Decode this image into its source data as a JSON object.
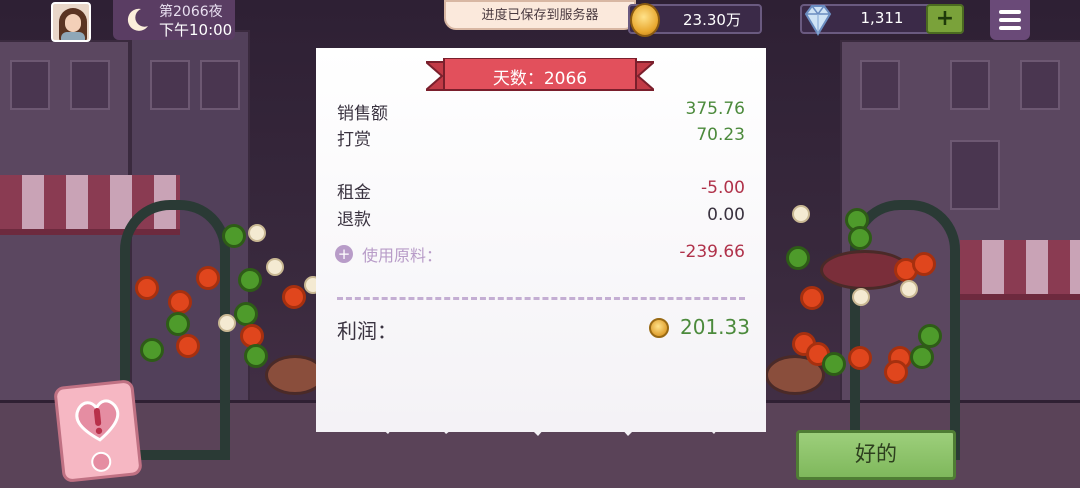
{
  "hud": {
    "day_label": "第2066夜",
    "time_label": "下午10:00",
    "save_toast": "进度已保存到服务器",
    "coins": "23.30万",
    "gems": "1,311",
    "add_gems_symbol": "+"
  },
  "receipt": {
    "banner": "天数：2066",
    "rows": [
      {
        "label": "销售额",
        "value": "375.76"
      },
      {
        "label": "打赏",
        "value": "70.23"
      },
      {
        "label": "租金",
        "value": "-5.00"
      },
      {
        "label": "退款",
        "value": "0.00"
      }
    ],
    "ingredients_label": "使用原料：",
    "ingredients_value": "-239.66",
    "profit_label": "利润：",
    "profit_value": "201.33"
  },
  "buttons": {
    "ok_label": "好的"
  },
  "colors": {
    "positive": "#4c8a3c",
    "negative": "#b0324a",
    "banner": "#e2505c",
    "ok_button": "#8cc46a"
  },
  "icons": [
    "avatar",
    "moon-icon",
    "coin-icon",
    "diamond-icon",
    "plus-icon",
    "menu-icon",
    "alert-heart-icon"
  ]
}
